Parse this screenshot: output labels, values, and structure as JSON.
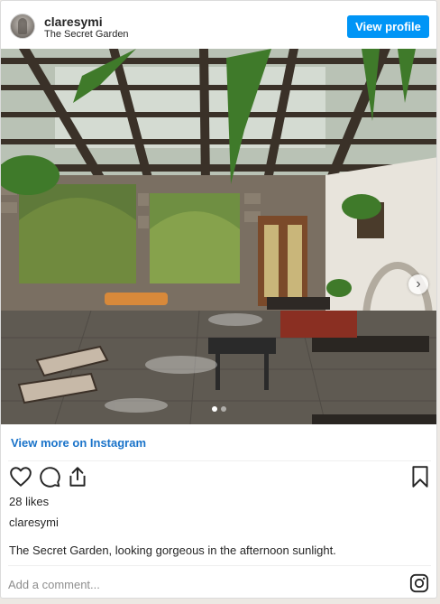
{
  "post": {
    "username": "claresymi",
    "location": "The Secret Garden",
    "view_profile_label": "View profile",
    "view_more_label": "View more on Instagram",
    "likes": "28 likes",
    "caption_user": "claresymi",
    "caption": "The Secret Garden, looking gorgeous in the afternoon sunlight.",
    "comment_placeholder": "Add a comment...",
    "carousel_current": 1,
    "carousel_total": 2
  },
  "colors": {
    "accent": "#0095f6",
    "link": "#1a73c9"
  },
  "icons": [
    "heart-icon",
    "comment-icon",
    "share-icon",
    "bookmark-icon",
    "instagram-icon",
    "chevron-right-icon"
  ]
}
